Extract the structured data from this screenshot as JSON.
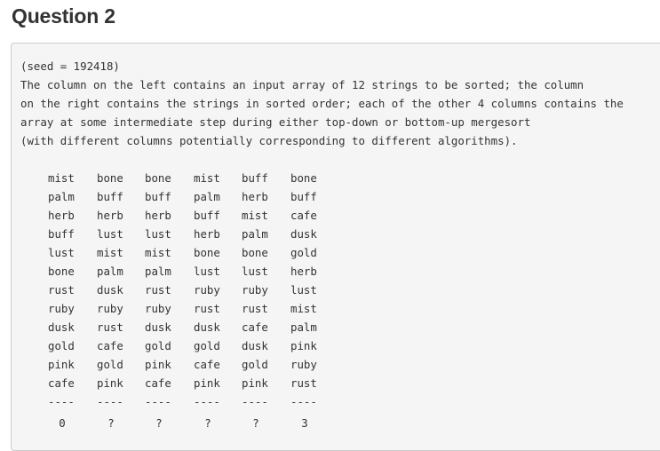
{
  "question": {
    "title": "Question 2",
    "seed_line": "(seed = 192418)",
    "description": [
      "The column on the left contains an input array of 12 strings to be sorted; the column",
      "on the right contains the strings in sorted order; each of the other 4 columns contains the",
      "array at some intermediate step during either top-down or bottom-up mergesort",
      "(with different columns potentially corresponding to different algorithms)."
    ],
    "columns": [
      [
        "mist",
        "palm",
        "herb",
        "buff",
        "lust",
        "bone",
        "rust",
        "ruby",
        "dusk",
        "gold",
        "pink",
        "cafe"
      ],
      [
        "bone",
        "buff",
        "herb",
        "lust",
        "mist",
        "palm",
        "dusk",
        "ruby",
        "rust",
        "cafe",
        "gold",
        "pink"
      ],
      [
        "bone",
        "buff",
        "herb",
        "lust",
        "mist",
        "palm",
        "rust",
        "ruby",
        "dusk",
        "gold",
        "pink",
        "cafe"
      ],
      [
        "mist",
        "palm",
        "buff",
        "herb",
        "bone",
        "lust",
        "ruby",
        "rust",
        "dusk",
        "gold",
        "cafe",
        "pink"
      ],
      [
        "buff",
        "herb",
        "mist",
        "palm",
        "bone",
        "lust",
        "ruby",
        "rust",
        "cafe",
        "dusk",
        "gold",
        "pink"
      ],
      [
        "bone",
        "buff",
        "cafe",
        "dusk",
        "gold",
        "herb",
        "lust",
        "mist",
        "palm",
        "pink",
        "ruby",
        "rust"
      ]
    ],
    "separator": "----",
    "footer": [
      "0",
      "?",
      "?",
      "?",
      "?",
      "3"
    ]
  }
}
